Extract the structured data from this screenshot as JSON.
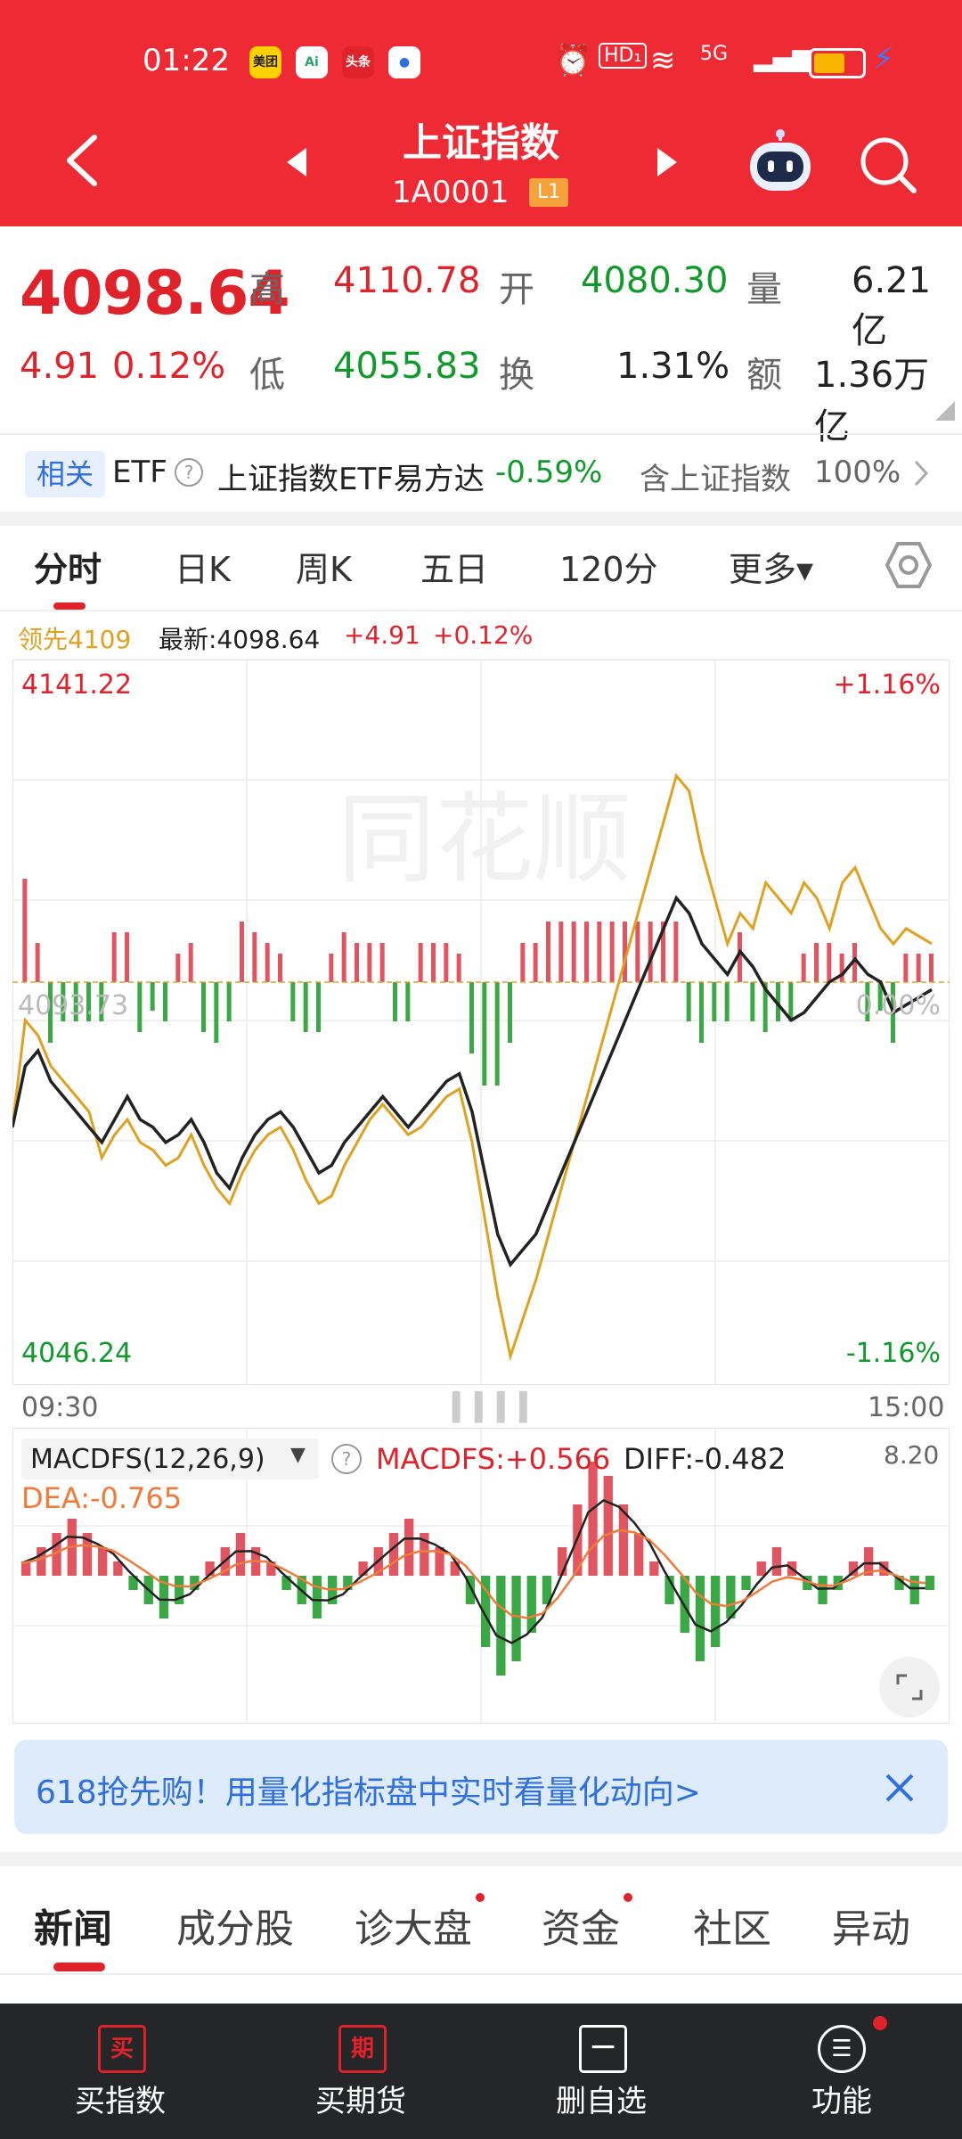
{
  "status_bar": {
    "time": "01:22",
    "apps": [
      "美团",
      "Ai",
      "头条",
      "●"
    ],
    "battery_label": "HD₁",
    "signal_label": "5G"
  },
  "header": {
    "title": "上证指数",
    "code": "1A0001",
    "level": "L1"
  },
  "quote": {
    "price": "4098.64",
    "change": "4.91",
    "change_pct": "0.12%",
    "high_label": "高",
    "high": "4110.78",
    "open_label": "开",
    "open": "4080.30",
    "volume_label": "量",
    "volume": "6.21亿",
    "low_label": "低",
    "low": "4055.83",
    "turnover_label": "换",
    "turnover": "1.31%",
    "amount_label": "额",
    "amount": "1.36万亿"
  },
  "etf": {
    "badge": "相关",
    "label": "ETF",
    "help": "?",
    "name": "上证指数ETF易方达",
    "change": "-0.59%",
    "contains": "含上证指数",
    "pct": "100%"
  },
  "chart_tabs": [
    "分时",
    "日K",
    "周K",
    "五日",
    "120分",
    "更多▾"
  ],
  "info": {
    "leader": "领先4109",
    "latest": "最新:4098.64",
    "change": "+4.91",
    "change_pct": "+0.12%"
  },
  "chart_data": [
    {
      "type": "line",
      "x_labels": [
        "09:30",
        "15:00"
      ],
      "ylim": [
        4046.24,
        4141.22
      ],
      "y_labels": {
        "top": "4141.22",
        "bottom": "4046.24",
        "mid_left": "4093.73"
      },
      "pct_labels": {
        "top": "+1.16%",
        "bottom": "-1.16%",
        "mid": "0.00%"
      },
      "watermark": "同花顺",
      "series": [
        {
          "name": "最新",
          "color": "#222222",
          "values": [
            4080,
            4088,
            4090,
            4086,
            4084,
            4082,
            4080,
            4078,
            4081,
            4084,
            4081,
            4080,
            4078,
            4079,
            4081,
            4078,
            4074,
            4072,
            4076,
            4079,
            4081,
            4082,
            4080,
            4077,
            4074,
            4075,
            4078,
            4080,
            4082,
            4084,
            4082,
            4080,
            4082,
            4084,
            4086,
            4087,
            4082,
            4074,
            4066,
            4062,
            4064,
            4066,
            4070,
            4074,
            4078,
            4082,
            4086,
            4090,
            4094,
            4098,
            4102,
            4106,
            4110,
            4108,
            4104,
            4102,
            4100,
            4103,
            4101,
            4098,
            4096,
            4094,
            4095,
            4097,
            4099,
            4100,
            4102,
            4100,
            4099,
            4095,
            4096,
            4097,
            4098
          ]
        },
        {
          "name": "领先",
          "color": "#e0a020",
          "values": [
            4080,
            4094,
            4092,
            4088,
            4086,
            4084,
            4082,
            4076,
            4079,
            4081,
            4078,
            4077,
            4075,
            4076,
            4079,
            4075,
            4072,
            4070,
            4074,
            4077,
            4079,
            4080,
            4077,
            4073,
            4070,
            4071,
            4075,
            4078,
            4081,
            4083,
            4081,
            4079,
            4080,
            4082,
            4084,
            4085,
            4078,
            4068,
            4058,
            4050,
            4055,
            4060,
            4066,
            4072,
            4078,
            4084,
            4090,
            4096,
            4102,
            4108,
            4114,
            4120,
            4126,
            4124,
            4116,
            4110,
            4104,
            4108,
            4106,
            4112,
            4110,
            4108,
            4112,
            4110,
            4106,
            4112,
            4114,
            4110,
            4106,
            4104,
            4106,
            4105,
            4104
          ]
        }
      ]
    },
    {
      "type": "bar",
      "title": "MACDFS(12,26,9)",
      "max_label": "8.20",
      "labels": {
        "macdfs": "MACDFS:+0.566",
        "diff": "DIFF:-0.482",
        "dea": "DEA:-0.765"
      },
      "values": [
        1,
        2,
        3,
        4,
        3,
        2,
        1,
        -1,
        -2,
        -3,
        -2,
        -1,
        1,
        2,
        3,
        2,
        1,
        -1,
        -2,
        -3,
        -2,
        -1,
        1,
        2,
        3,
        4,
        3,
        2,
        1,
        -2,
        -5,
        -7,
        -6,
        -4,
        -2,
        2,
        5,
        8,
        7,
        5,
        3,
        1,
        -2,
        -4,
        -6,
        -5,
        -3,
        -1,
        1,
        2,
        1,
        -1,
        -2,
        -1,
        1,
        2,
        1,
        -1,
        -2,
        -1
      ]
    }
  ],
  "banner": {
    "text": "618抢先购！用量化指标盘中实时看量化动向>"
  },
  "news_tabs": [
    "新闻",
    "成分股",
    "诊大盘",
    "资金",
    "社区",
    "异动"
  ],
  "nav": [
    {
      "icon": "买",
      "label": "买指数"
    },
    {
      "icon": "期",
      "label": "买期货"
    },
    {
      "icon": "一",
      "label": "删自选"
    },
    {
      "icon": "☰",
      "label": "功能"
    }
  ],
  "colors": {
    "accent": "#ee2a35",
    "up": "#e0222b",
    "down": "#0f9a2b",
    "leader": "#e0a020",
    "link": "#2f6fe0"
  }
}
